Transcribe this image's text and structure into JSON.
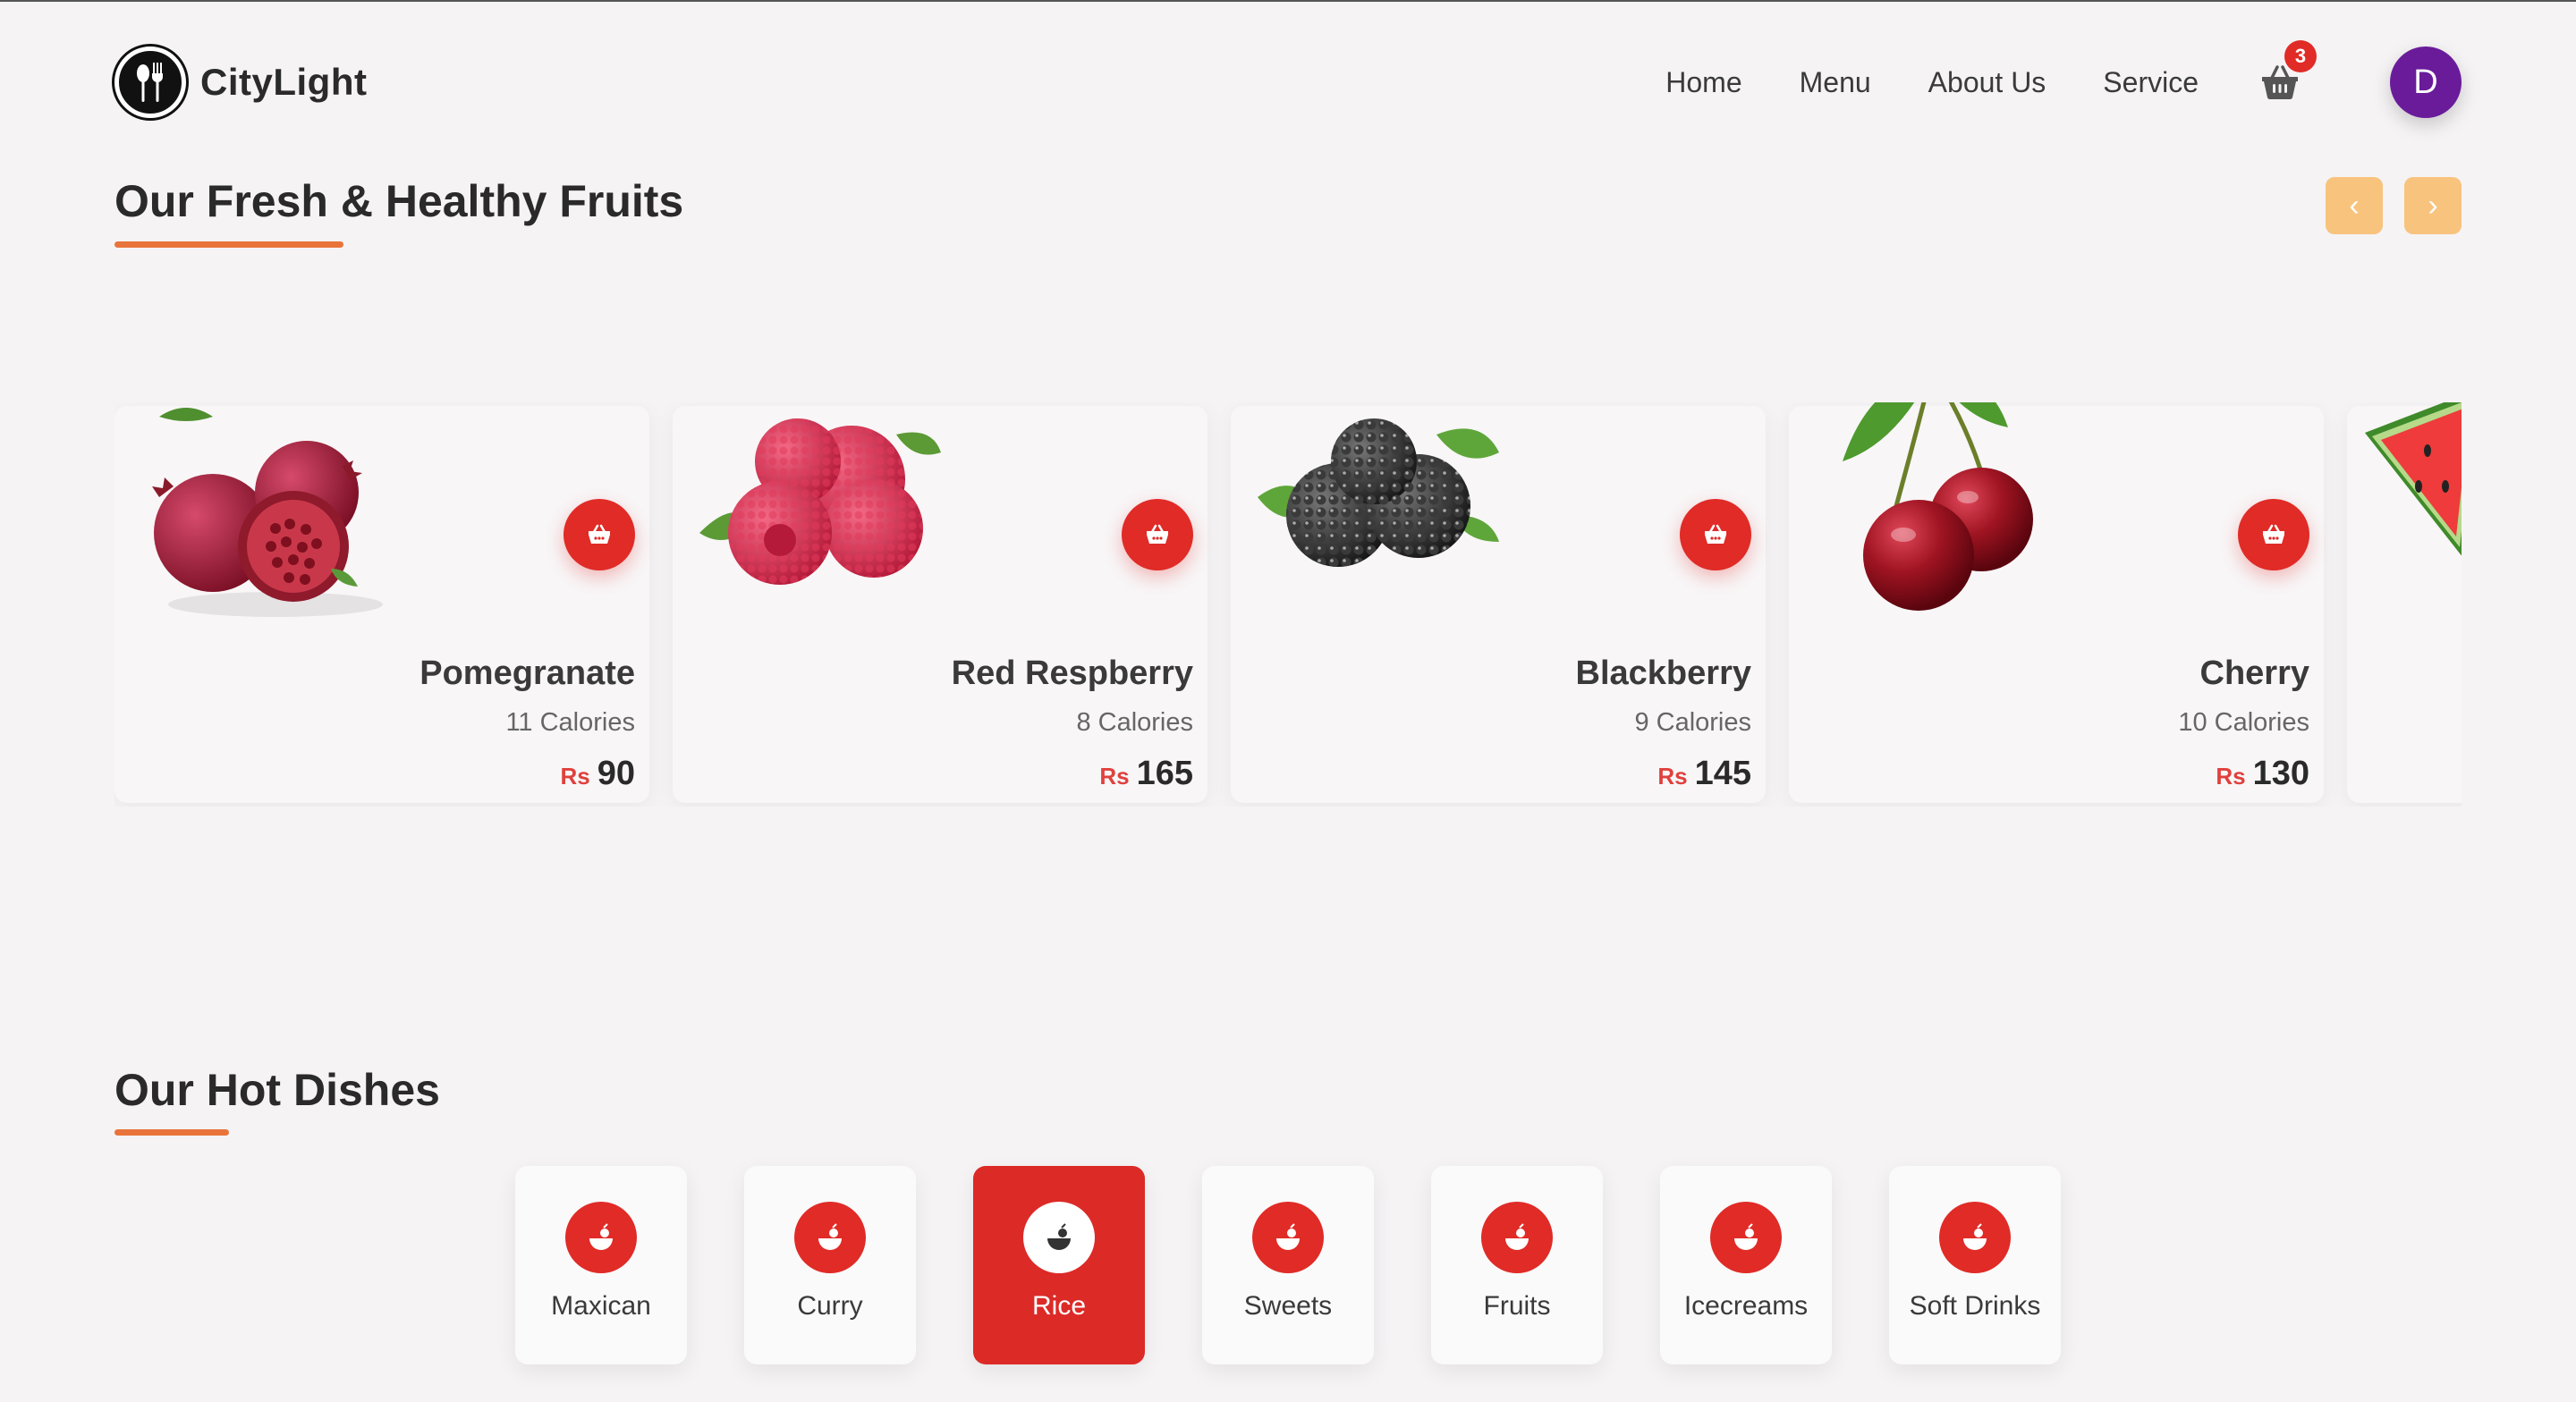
{
  "brand": {
    "name": "CityLight",
    "logo_icon": "fork-spoon-icon"
  },
  "nav": {
    "links": [
      "Home",
      "Menu",
      "About Us",
      "Service"
    ],
    "cart_count": "3",
    "avatar_initial": "D"
  },
  "fruits_section": {
    "title": "Our Fresh & Healthy Fruits",
    "prev_label": "‹",
    "next_label": "›"
  },
  "fruits": [
    {
      "name": "Pomegranate",
      "calories": "11 Calories",
      "currency": "Rs",
      "price": "90"
    },
    {
      "name": "Red Respberry",
      "calories": "8 Calories",
      "currency": "Rs",
      "price": "165"
    },
    {
      "name": "Blackberry",
      "calories": "9 Calories",
      "currency": "Rs",
      "price": "145"
    },
    {
      "name": "Cherry",
      "calories": "10 Calories",
      "currency": "Rs",
      "price": "130"
    }
  ],
  "dishes_section": {
    "title": "Our Hot Dishes"
  },
  "categories": [
    "Maxican",
    "Curry",
    "Rice",
    "Sweets",
    "Fruits",
    "Icecreams",
    "Soft Drinks"
  ],
  "active_category": "Rice",
  "colors": {
    "accent": "#e02b27",
    "underline": "#e8743b",
    "arrow": "#f8c37d",
    "avatar": "#6a1b9a"
  }
}
